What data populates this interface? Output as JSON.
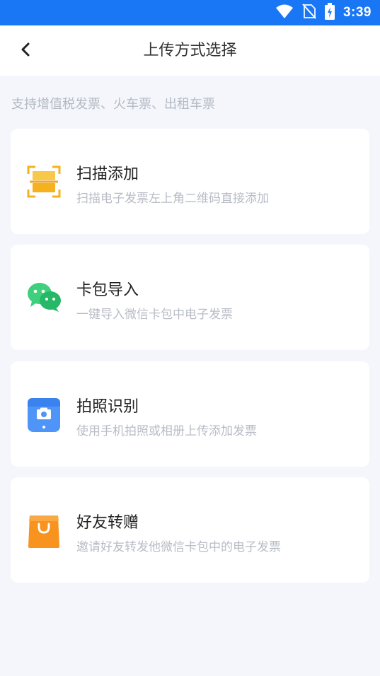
{
  "status_bar": {
    "time": "3:39",
    "icons": [
      "wifi-icon",
      "no-sim-icon",
      "battery-charging-icon"
    ]
  },
  "header": {
    "title": "上传方式选择",
    "back_icon": "back-chevron-icon"
  },
  "hint": "支持增值税发票、火车票、出租车票",
  "options": [
    {
      "label": "扫描添加",
      "desc": "扫描电子发票左上角二维码直接添加",
      "icon": "scan-icon",
      "color": "#f5b21e"
    },
    {
      "label": "卡包导入",
      "desc": "一键导入微信卡包中电子发票",
      "icon": "wechat-icon",
      "color": "#2fc06a"
    },
    {
      "label": "拍照识别",
      "desc": "使用手机拍照或相册上传添加发票",
      "icon": "camera-icon",
      "color": "#3d8cf5"
    },
    {
      "label": "好友转赠",
      "desc": "邀请好友转发他微信卡包中的电子发票",
      "icon": "gift-bag-icon",
      "color": "#f7931e"
    }
  ],
  "colors": {
    "status_bar": "#1976f5",
    "background": "#f4f6fb"
  }
}
